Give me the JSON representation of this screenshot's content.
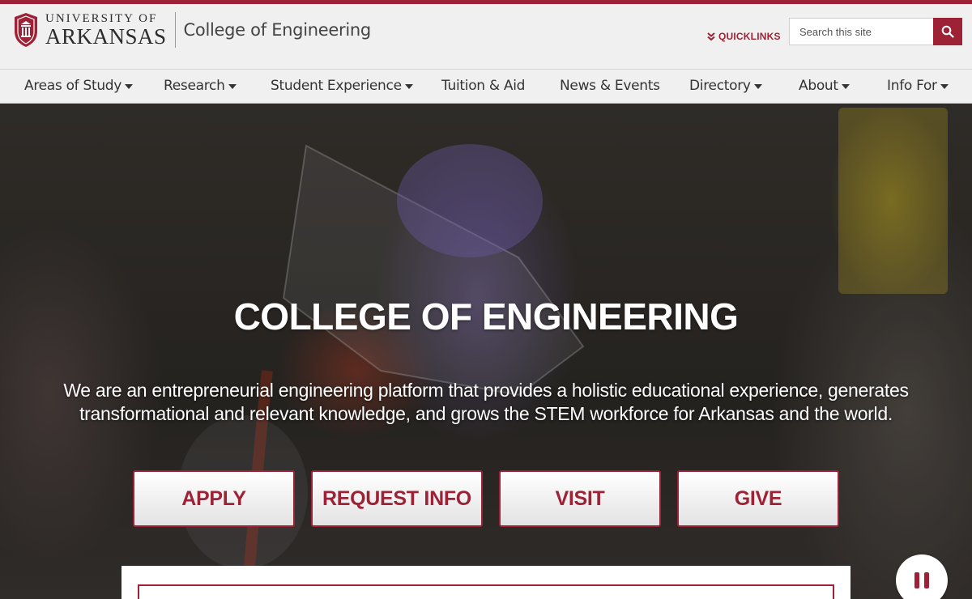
{
  "header": {
    "logo": {
      "line1": "UNIVERSITY OF",
      "line2": "ARKANSAS"
    },
    "college_name": "College of Engineering",
    "quicklinks_label": "QUICKLINKS",
    "search": {
      "placeholder": "Search this site",
      "value": ""
    }
  },
  "nav": {
    "items": [
      {
        "label": "Areas of Study",
        "dropdown": true
      },
      {
        "label": "Research",
        "dropdown": true
      },
      {
        "label": "Student Experience",
        "dropdown": true
      },
      {
        "label": "Tuition & Aid",
        "dropdown": false
      },
      {
        "label": "News & Events",
        "dropdown": false
      },
      {
        "label": "Directory",
        "dropdown": true
      },
      {
        "label": "About",
        "dropdown": true
      },
      {
        "label": "Info For",
        "dropdown": true
      }
    ]
  },
  "hero": {
    "title": "COLLEGE OF ENGINEERING",
    "text": "We are an entrepreneurial engineering platform that provides a holistic educational experience, generates transformational and relevant knowledge, and grows the STEM workforce for Arkansas and the world.",
    "buttons": [
      {
        "label": "APPLY"
      },
      {
        "label": "REQUEST INFO"
      },
      {
        "label": "VISIT"
      },
      {
        "label": "GIVE"
      }
    ]
  },
  "colors": {
    "brand": "#9d2235",
    "header_bg": "#f0f0f0",
    "text_dark": "#333333"
  },
  "icons": {
    "seal": "university-seal-icon",
    "quicklinks": "double-chevron-down-icon",
    "search": "search-icon",
    "pause": "pause-icon",
    "caret": "caret-down-icon"
  }
}
